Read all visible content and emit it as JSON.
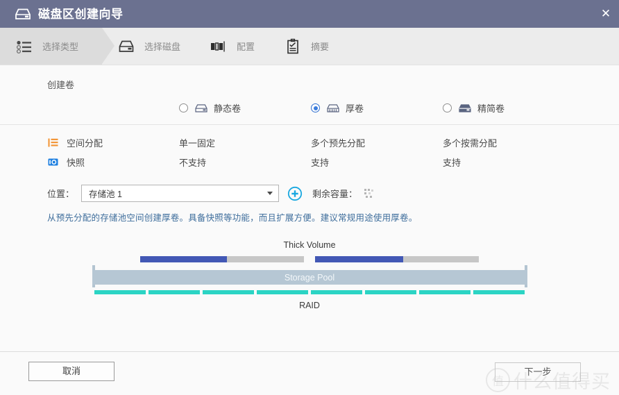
{
  "window": {
    "title": "磁盘区创建向导",
    "title_icon": "nas-drive-icon",
    "close_label": "✕"
  },
  "steps": [
    {
      "label": "选择类型",
      "icon": "list-options-icon",
      "active": true
    },
    {
      "label": "选择磁盘",
      "icon": "nas-drive-icon",
      "active": false
    },
    {
      "label": "配置",
      "icon": "volume-blocks-icon",
      "active": false
    },
    {
      "label": "摘要",
      "icon": "clipboard-check-icon",
      "active": false
    }
  ],
  "main": {
    "section_title": "创建卷",
    "volume_types": [
      {
        "label": "静态卷",
        "selected": false,
        "icon": "static-volume-icon"
      },
      {
        "label": "厚卷",
        "selected": true,
        "icon": "thick-volume-icon"
      },
      {
        "label": "精简卷",
        "selected": false,
        "icon": "thin-volume-icon"
      }
    ],
    "features": [
      {
        "name": "空间分配",
        "icon": "space-allocation-icon",
        "icon_color": "#f29230",
        "values": [
          "单一固定",
          "多个预先分配",
          "多个按需分配"
        ]
      },
      {
        "name": "快照",
        "icon": "snapshot-icon",
        "icon_color": "#1d7fe0",
        "values": [
          "不支持",
          "支持",
          "支持"
        ]
      }
    ],
    "location": {
      "label": "位置：",
      "selected": "存储池 1",
      "options": [
        "存储池 1"
      ],
      "add_icon": "plus-circle-icon",
      "capacity_label": "剩余容量：",
      "capacity_value": "",
      "loading_icon": "loading-dots-icon"
    },
    "description": "从预先分配的存储池空间创建厚卷。具备快照等功能，而且扩展方便。建议常规用途使用厚卷。",
    "diagram": {
      "top_label": "Thick Volume",
      "pool_label": "Storage Pool",
      "bottom_label": "RAID",
      "volume_bars": [
        {
          "fill_percent": 53
        },
        {
          "fill_percent": 54
        }
      ],
      "raid_segment_count": 8,
      "colors": {
        "volume_fill": "#4258b5",
        "volume_empty": "#c7c7c7",
        "pool": "#b6c7d4",
        "raid": "#2bd4c4"
      }
    }
  },
  "footer": {
    "cancel_label": "取消",
    "next_label": "下一步"
  },
  "watermark": {
    "mark": "值",
    "text": "什么值得买"
  }
}
